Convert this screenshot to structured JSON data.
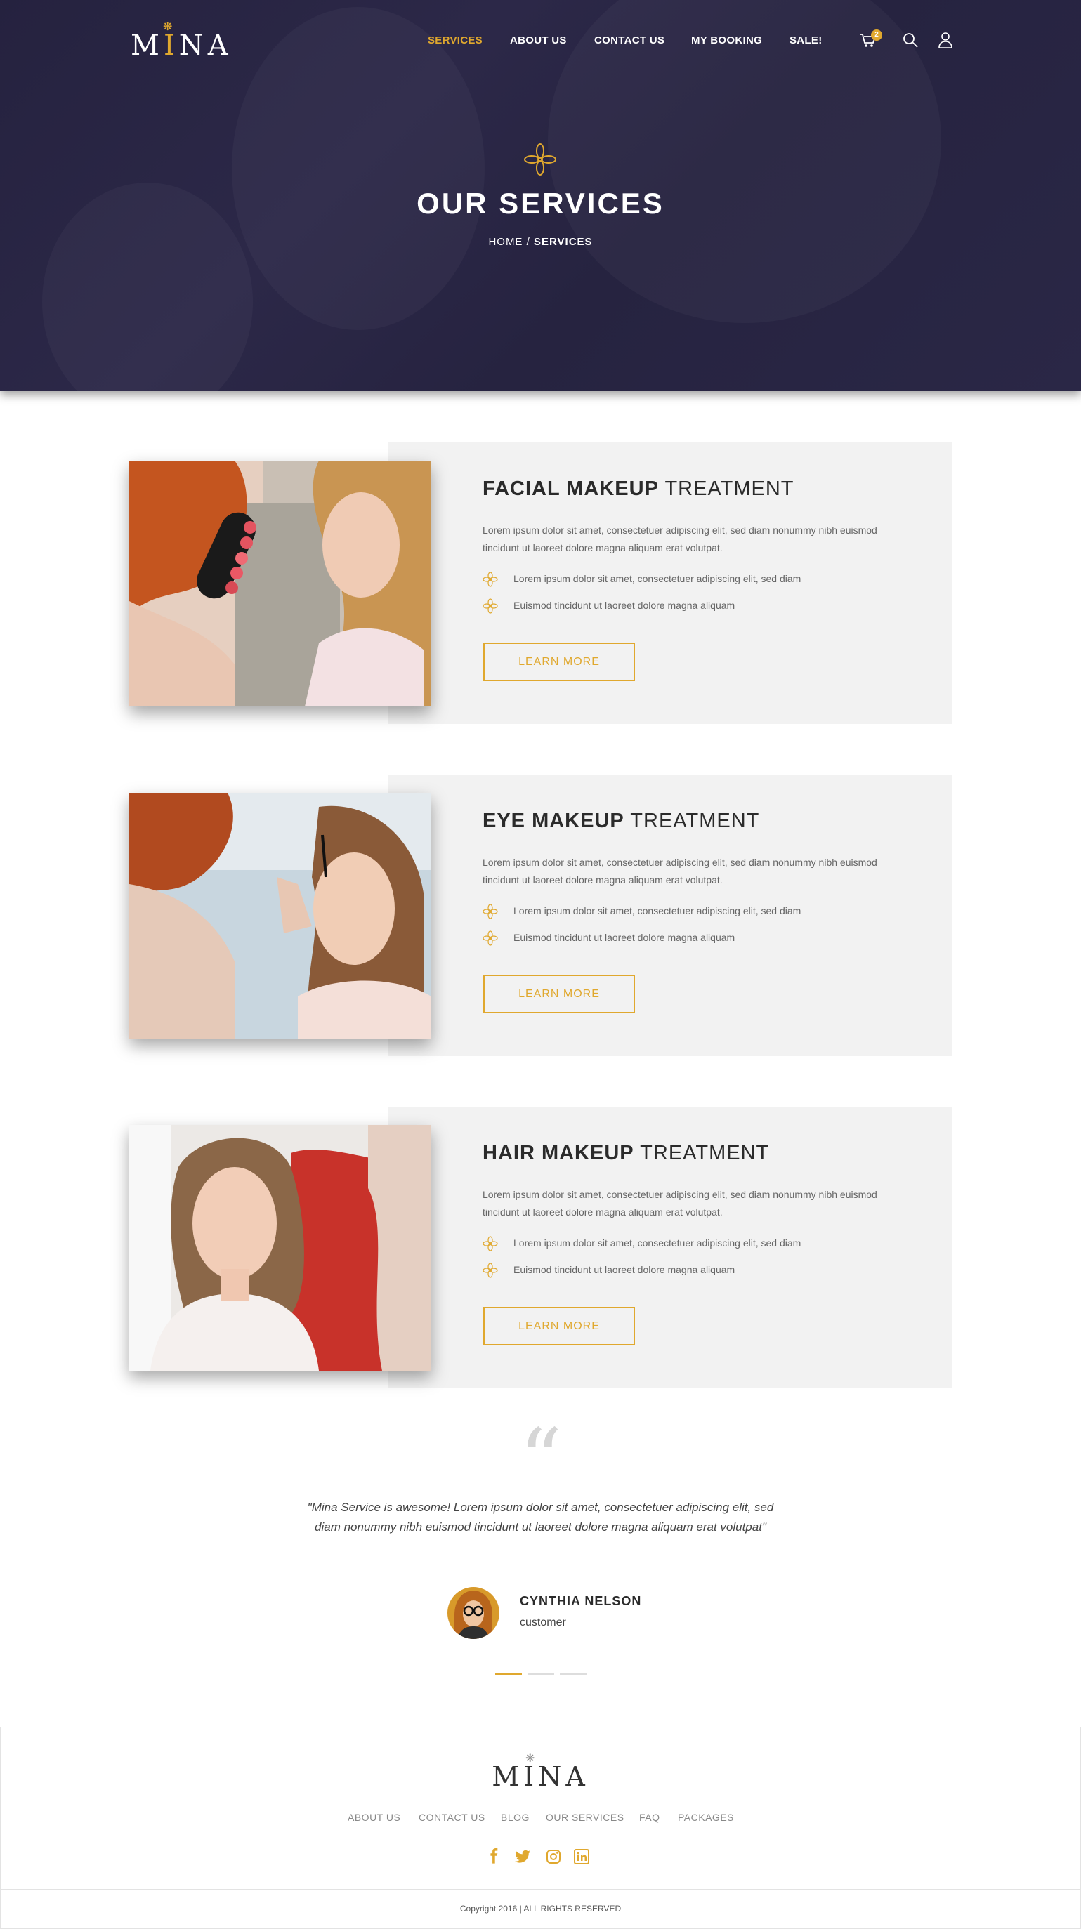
{
  "brand": {
    "logo_text": "MINA",
    "accent_color": "#e0a82e",
    "hero_color": "#28243f"
  },
  "nav": {
    "items": [
      {
        "label": "SERVICES",
        "active": true
      },
      {
        "label": "ABOUT US",
        "active": false
      },
      {
        "label": "CONTACT US",
        "active": false
      },
      {
        "label": "MY BOOKING",
        "active": false
      },
      {
        "label": "SALE!",
        "active": false
      }
    ],
    "cart_count": "2",
    "icons": [
      "cart-icon",
      "search-icon",
      "user-icon"
    ]
  },
  "hero": {
    "title": "OUR SERVICES",
    "breadcrumb_home": "HOME",
    "breadcrumb_sep": " / ",
    "breadcrumb_current": "SERVICES"
  },
  "services": [
    {
      "title_bold": "FACIAL MAKEUP",
      "title_light": " TREATMENT",
      "description": "Lorem ipsum dolor sit amet, consectetuer adipiscing elit, sed diam nonummy nibh euismod tincidunt ut laoreet dolore magna aliquam erat volutpat.",
      "bullets": [
        "Lorem ipsum dolor sit amet, consectetuer adipiscing elit, sed diam",
        "Euismod tincidunt ut laoreet dolore magna aliquam"
      ],
      "button": "LEARN MORE"
    },
    {
      "title_bold": "EYE MAKEUP",
      "title_light": " TREATMENT",
      "description": "Lorem ipsum dolor sit amet, consectetuer adipiscing elit, sed diam nonummy nibh euismod tincidunt ut laoreet dolore magna aliquam erat volutpat.",
      "bullets": [
        "Lorem ipsum dolor sit amet, consectetuer adipiscing elit, sed diam",
        "Euismod tincidunt ut laoreet dolore magna aliquam"
      ],
      "button": "LEARN MORE"
    },
    {
      "title_bold": "HAIR MAKEUP",
      "title_light": " TREATMENT",
      "description": "Lorem ipsum dolor sit amet, consectetuer adipiscing elit, sed diam nonummy nibh euismod tincidunt ut laoreet dolore magna aliquam erat volutpat.",
      "bullets": [
        "Lorem ipsum dolor sit amet, consectetuer adipiscing elit, sed diam",
        "Euismod tincidunt ut laoreet dolore magna aliquam"
      ],
      "button": "LEARN MORE"
    }
  ],
  "testimonial": {
    "quote": "\"Mina Service is awesome! Lorem ipsum dolor sit amet, consectetuer adipiscing elit, sed diam nonummy nibh euismod tincidunt ut laoreet dolore magna aliquam erat volutpat\"",
    "name": "CYNTHIA NELSON",
    "role": "customer",
    "active_slide": 1,
    "slide_count": 3
  },
  "footer": {
    "logo_text": "MINA",
    "links": [
      "ABOUT US",
      "CONTACT US",
      "BLOG",
      "OUR SERVICES",
      "FAQ",
      "PACKAGES"
    ],
    "social": [
      "facebook-icon",
      "twitter-icon",
      "instagram-icon",
      "linkedin-icon"
    ],
    "copyright": "Copyright 2016 | ALL RIGHTS RESERVED"
  }
}
